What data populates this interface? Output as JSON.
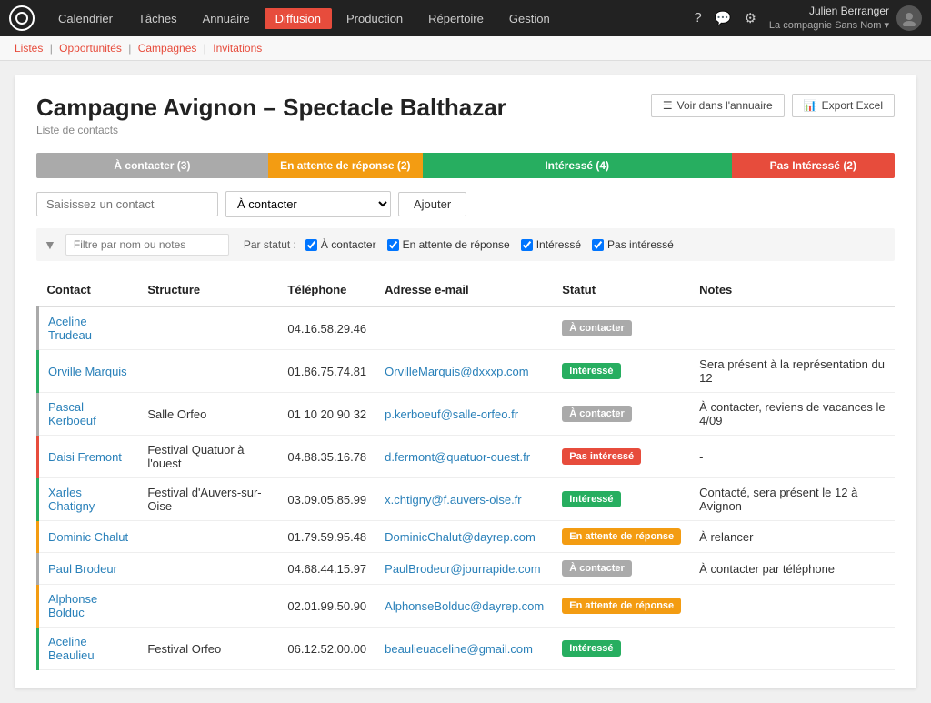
{
  "topnav": {
    "logo_text": "○",
    "items": [
      {
        "label": "Calendrier",
        "active": false
      },
      {
        "label": "Tâches",
        "active": false
      },
      {
        "label": "Annuaire",
        "active": false
      },
      {
        "label": "Diffusion",
        "active": true
      },
      {
        "label": "Production",
        "active": false
      },
      {
        "label": "Répertoire",
        "active": false
      },
      {
        "label": "Gestion",
        "active": false
      }
    ],
    "help_icon": "?",
    "chat_icon": "💬",
    "settings_icon": "⚙",
    "user_name": "Julien Berranger",
    "user_company": "La compagnie Sans Nom ▾"
  },
  "subnav": {
    "items": [
      "Listes",
      "Opportunités",
      "Campagnes",
      "Invitations"
    ]
  },
  "page": {
    "title": "Campagne Avignon – Spectacle Balthazar",
    "subtitle": "Liste de contacts",
    "btn_annuaire": "Voir dans l'annuaire",
    "btn_excel": "Export Excel"
  },
  "progress": {
    "segments": [
      {
        "label": "À contacter (3)",
        "color": "#aaa",
        "width": 27
      },
      {
        "label": "En attente de réponse (2)",
        "color": "#f39c12",
        "width": 18
      },
      {
        "label": "Intéressé (4)",
        "color": "#27ae60",
        "width": 36
      },
      {
        "label": "Pas Intéressé (2)",
        "color": "#e74c3c",
        "width": 19
      }
    ]
  },
  "add_contact": {
    "placeholder": "Saisissez un contact",
    "select_value": "À contacter",
    "select_options": [
      "À contacter",
      "En attente de réponse",
      "Intéressé",
      "Pas intéressé"
    ],
    "btn_label": "Ajouter"
  },
  "filter": {
    "placeholder": "Filtre par nom ou notes",
    "par_statut_label": "Par statut :",
    "checkboxes": [
      {
        "label": "À contacter",
        "checked": true
      },
      {
        "label": "En attente de réponse",
        "checked": true
      },
      {
        "label": "Intéressé",
        "checked": true
      },
      {
        "label": "Pas intéressé",
        "checked": true
      }
    ]
  },
  "table": {
    "headers": [
      "Contact",
      "Structure",
      "Téléphone",
      "Adresse e-mail",
      "Statut",
      "Notes"
    ],
    "rows": [
      {
        "contact": "Aceline Trudeau",
        "structure": "",
        "telephone": "04.16.58.29.46",
        "email": "",
        "statut": "À contacter",
        "statut_type": "grey",
        "notes": "",
        "row_color": "grey"
      },
      {
        "contact": "Orville Marquis",
        "structure": "",
        "telephone": "01.86.75.74.81",
        "email": "OrvilleMarquis@dxxxp.com",
        "statut": "Intéressé",
        "statut_type": "green",
        "notes": "Sera présent à la représentation du 12",
        "row_color": "green"
      },
      {
        "contact": "Pascal Kerboeuf",
        "structure": "Salle Orfeo",
        "telephone": "01 10 20 90 32",
        "email": "p.kerboeuf@salle-orfeo.fr",
        "statut": "À contacter",
        "statut_type": "grey",
        "notes": "À contacter, reviens de vacances le 4/09",
        "row_color": "grey"
      },
      {
        "contact": "Daisi Fremont",
        "structure": "Festival Quatuor à l'ouest",
        "telephone": "04.88.35.16.78",
        "email": "d.fermont@quatuor-ouest.fr",
        "statut": "Pas intéressé",
        "statut_type": "red",
        "notes": "-",
        "row_color": "red"
      },
      {
        "contact": "Xarles Chatigny",
        "structure": "Festival d'Auvers-sur-Oise",
        "telephone": "03.09.05.85.99",
        "email": "x.chtigny@f.auvers-oise.fr",
        "statut": "Intéressé",
        "statut_type": "green",
        "notes": "Contacté, sera présent le 12 à Avignon",
        "row_color": "green"
      },
      {
        "contact": "Dominic Chalut",
        "structure": "",
        "telephone": "01.79.59.95.48",
        "email": "DominicChalut@dayrep.com",
        "statut": "En attente de réponse",
        "statut_type": "orange",
        "notes": "À relancer",
        "row_color": "orange"
      },
      {
        "contact": "Paul Brodeur",
        "structure": "",
        "telephone": "04.68.44.15.97",
        "email": "PaulBrodeur@jourrapide.com",
        "statut": "À contacter",
        "statut_type": "grey",
        "notes": "À contacter par téléphone",
        "row_color": "grey"
      },
      {
        "contact": "Alphonse Bolduc",
        "structure": "",
        "telephone": "02.01.99.50.90",
        "email": "AlphonseBolduc@dayrep.com",
        "statut": "En attente de réponse",
        "statut_type": "orange",
        "notes": "",
        "row_color": "orange"
      },
      {
        "contact": "Aceline Beaulieu",
        "structure": "Festival Orfeo",
        "telephone": "06.12.52.00.00",
        "email": "beaulieuaceline@gmail.com",
        "statut": "Intéressé",
        "statut_type": "green",
        "notes": "",
        "row_color": "green"
      }
    ]
  }
}
